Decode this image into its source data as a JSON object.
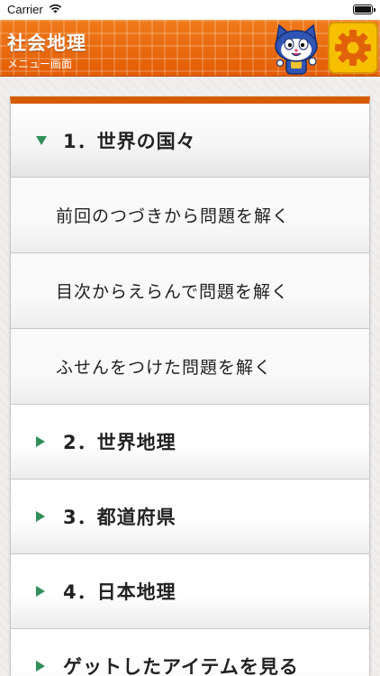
{
  "status_bar": {
    "carrier": "Carrier"
  },
  "header": {
    "title": "社会地理",
    "subtitle": "メニュー画面",
    "accent_color": "#e8650a",
    "settings_color": "#f6c000"
  },
  "menu": {
    "sections": [
      {
        "label": "1．世界の国々",
        "expanded": true,
        "items": [
          {
            "label": "前回のつづきから問題を解く"
          },
          {
            "label": "目次からえらんで問題を解く"
          },
          {
            "label": "ふせんをつけた問題を解く"
          }
        ]
      },
      {
        "label": "2．世界地理",
        "expanded": false
      },
      {
        "label": "3．都道府県",
        "expanded": false
      },
      {
        "label": "4．日本地理",
        "expanded": false
      },
      {
        "label": "ゲットしたアイテムを見る",
        "expanded": false
      }
    ]
  }
}
